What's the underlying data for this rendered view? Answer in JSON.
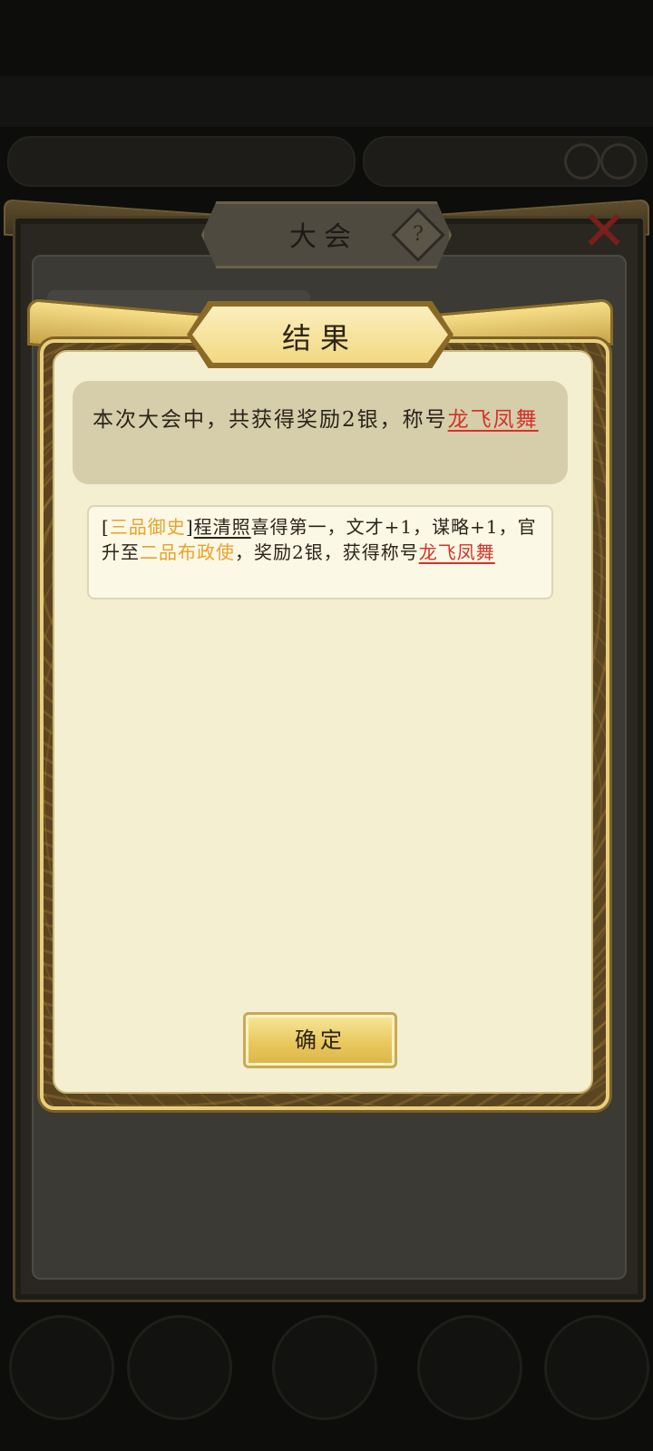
{
  "background": {
    "panel_title": "大会",
    "help_icon": "?",
    "close_icon": "✕"
  },
  "dialog": {
    "title": "结果",
    "summary": {
      "text": "本次大会中，共获得奖励2银，称号",
      "honor": "龙飞凤舞"
    },
    "record": {
      "bracket_open": "[",
      "rank": "三品御史",
      "bracket_close": "]",
      "name": "程清照",
      "text1": "喜得第一，文才+1，谋略+1，官升至",
      "new_rank": "二品布政使",
      "text2": "，奖励2银，获得称号",
      "honor": "龙飞凤舞"
    },
    "confirm_label": "确定"
  },
  "colors": {
    "gold_accent": "#e8a22a",
    "honor_red": "#d3332a",
    "panel_cream": "#f4efd0"
  }
}
